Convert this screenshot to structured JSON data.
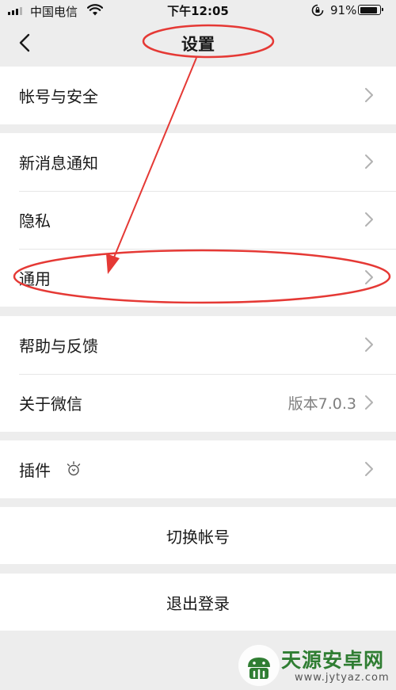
{
  "status_bar": {
    "carrier": "中国电信",
    "time": "下午12:05",
    "battery_text": "91%",
    "battery_level": 0.91
  },
  "nav": {
    "title": "设置",
    "back_icon": "chevron-left-icon"
  },
  "groups": [
    {
      "rows": [
        {
          "label": "帐号与安全"
        }
      ]
    },
    {
      "rows": [
        {
          "label": "新消息通知"
        },
        {
          "label": "隐私"
        },
        {
          "label": "通用"
        }
      ]
    },
    {
      "rows": [
        {
          "label": "帮助与反馈"
        },
        {
          "label": "关于微信",
          "value": "版本7.0.3"
        }
      ]
    },
    {
      "rows": [
        {
          "label": "插件",
          "icon": "plugin-bulb-icon"
        }
      ]
    }
  ],
  "actions": {
    "switch_account": "切换帐号",
    "logout": "退出登录"
  },
  "watermark": {
    "name": "天源安卓网",
    "url": "www.jytyaz.com"
  },
  "colors": {
    "background": "#ededed",
    "annotation": "#e53935",
    "secondary_text": "#7f7f7f",
    "watermark": "#2f7d32"
  }
}
